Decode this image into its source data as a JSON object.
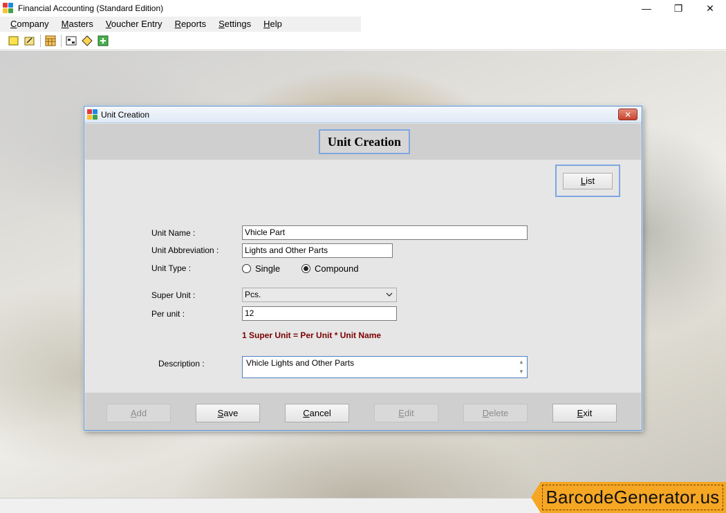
{
  "app": {
    "title": "Financial Accounting (Standard Edition)",
    "controls": {
      "minimize": "—",
      "maximize": "❐",
      "close": "✕"
    }
  },
  "menu": [
    {
      "label": "Company",
      "underline": "C",
      "rest": "ompany"
    },
    {
      "label": "Masters",
      "underline": "M",
      "rest": "asters"
    },
    {
      "label": "Voucher Entry",
      "underline": "V",
      "rest": "oucher Entry"
    },
    {
      "label": "Reports",
      "underline": "R",
      "rest": "eports"
    },
    {
      "label": "Settings",
      "underline": "S",
      "rest": "ettings"
    },
    {
      "label": "Help",
      "underline": "H",
      "rest": "elp"
    }
  ],
  "toolbar_icons": [
    "new-icon",
    "open-icon",
    "calculator-icon",
    "calendar-icon",
    "tag-icon",
    "export-icon"
  ],
  "dialog": {
    "title": "Unit Creation",
    "header": "Unit Creation",
    "list_button": {
      "u": "L",
      "rest": "ist"
    },
    "fields": {
      "unit_name": {
        "label": "Unit Name :",
        "value": "Vhicle Part"
      },
      "unit_abbreviation": {
        "label": "Unit Abbreviation :",
        "value": "Lights and Other Parts"
      },
      "unit_type": {
        "label": "Unit Type :",
        "options": [
          "Single",
          "Compound"
        ],
        "selected": "Compound"
      },
      "super_unit": {
        "label": "Super Unit :",
        "value": "Pcs."
      },
      "per_unit": {
        "label": "Per unit :",
        "value": "12"
      },
      "formula": "1 Super Unit = Per Unit * Unit Name",
      "description": {
        "label": "Description :",
        "value": "Vhicle Lights and Other Parts"
      }
    },
    "buttons": {
      "add": {
        "u": "A",
        "rest": "dd"
      },
      "save": {
        "u": "S",
        "rest": "ave"
      },
      "cancel": {
        "u": "C",
        "rest": "ancel"
      },
      "edit": {
        "u": "E",
        "rest": "dit"
      },
      "delete": {
        "u": "D",
        "rest": "elete"
      },
      "exit": {
        "u": "E",
        "rest": "xit"
      }
    }
  },
  "watermark": "BarcodeGenerator.us",
  "colors": {
    "accent_frame": "#7ea6e0",
    "formula_text": "#7a0000",
    "watermark_bg": "#f5a623"
  }
}
